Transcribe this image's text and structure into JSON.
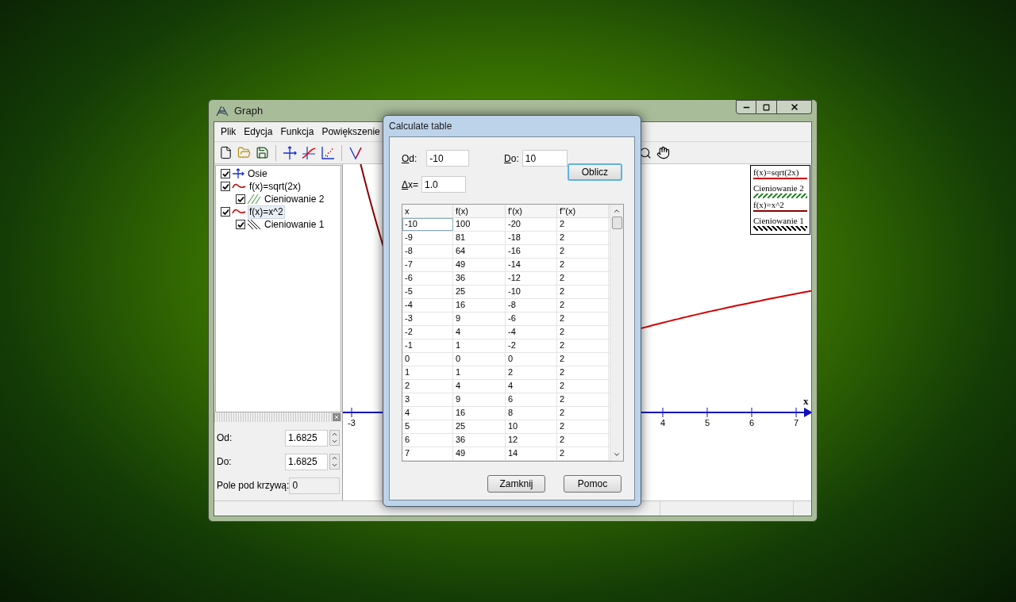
{
  "window": {
    "title": "Graph"
  },
  "menu": [
    "Plik",
    "Edycja",
    "Funkcja",
    "Powiększenie"
  ],
  "tree": [
    {
      "label": "Osie",
      "kind": "axes",
      "checked": true,
      "selected": false
    },
    {
      "label": "f(x)=sqrt(2x)",
      "kind": "curve",
      "checked": true,
      "selected": false,
      "children": [
        {
          "label": "Cieniowanie 2",
          "kind": "hatch-green",
          "checked": true,
          "selected": false
        }
      ]
    },
    {
      "label": "f(x)=x^2",
      "kind": "curve",
      "checked": true,
      "selected": true,
      "children": [
        {
          "label": "Cieniowanie 1",
          "kind": "hatch-black",
          "checked": true,
          "selected": false
        }
      ]
    }
  ],
  "area_panel": {
    "fields": [
      {
        "label": "Od:",
        "value": "1.6825",
        "kind": "spin"
      },
      {
        "label": "Do:",
        "value": "1.6825",
        "kind": "spin"
      },
      {
        "label": "Pole pod krzywą:",
        "value": "0",
        "kind": "readonly"
      }
    ]
  },
  "graph": {
    "x_ticks": [
      "-3",
      "4",
      "5",
      "6",
      "7"
    ],
    "axis_label": "x",
    "legend": [
      {
        "label": "f(x)=sqrt(2x)",
        "kind": "line",
        "color": "#d40000"
      },
      {
        "label": "Cieniowanie 2",
        "kind": "hatch",
        "color": "#2e8b2e"
      },
      {
        "label": "f(x)=x^2",
        "kind": "line",
        "color": "#8b0000"
      },
      {
        "label": "Cieniowanie 1",
        "kind": "hatch",
        "color": "#000000"
      }
    ]
  },
  "dialog": {
    "title": "Calculate table",
    "from": {
      "label": "Od:",
      "value": "-10"
    },
    "to": {
      "label": "Do:",
      "value": "10"
    },
    "step": {
      "label": "Δx=",
      "value": "1.0"
    },
    "compute_button": "Oblicz",
    "table": {
      "columns": [
        "x",
        "f(x)",
        "f'(x)",
        "f''(x)"
      ],
      "rows": [
        [
          "-10",
          "100",
          "-20",
          "2"
        ],
        [
          "-9",
          "81",
          "-18",
          "2"
        ],
        [
          "-8",
          "64",
          "-16",
          "2"
        ],
        [
          "-7",
          "49",
          "-14",
          "2"
        ],
        [
          "-6",
          "36",
          "-12",
          "2"
        ],
        [
          "-5",
          "25",
          "-10",
          "2"
        ],
        [
          "-4",
          "16",
          "-8",
          "2"
        ],
        [
          "-3",
          "9",
          "-6",
          "2"
        ],
        [
          "-2",
          "4",
          "-4",
          "2"
        ],
        [
          "-1",
          "1",
          "-2",
          "2"
        ],
        [
          "0",
          "0",
          "0",
          "2"
        ],
        [
          "1",
          "1",
          "2",
          "2"
        ],
        [
          "2",
          "4",
          "4",
          "2"
        ],
        [
          "3",
          "9",
          "6",
          "2"
        ],
        [
          "4",
          "16",
          "8",
          "2"
        ],
        [
          "5",
          "25",
          "10",
          "2"
        ],
        [
          "6",
          "36",
          "12",
          "2"
        ],
        [
          "7",
          "49",
          "14",
          "2"
        ]
      ]
    },
    "buttons": [
      "Zamknij",
      "Pomoc"
    ]
  }
}
